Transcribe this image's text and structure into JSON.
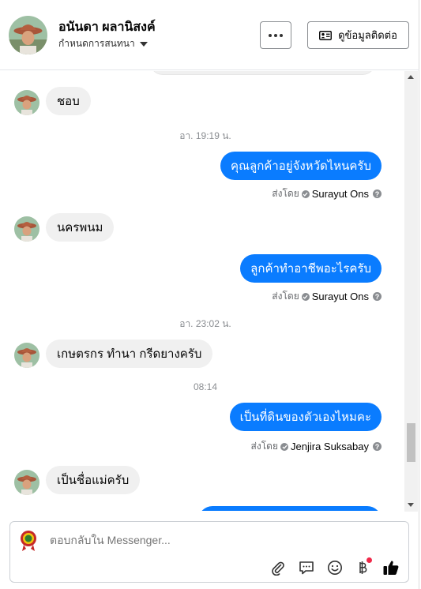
{
  "header": {
    "name": "อนันดา ผลานิสงค์",
    "subtitle": "กำหนดการสนทนา",
    "contact_button_label": "ดูข้อมูลติดต่อ",
    "more_button_icon": "ellipsis-icon"
  },
  "messages": {
    "m1": {
      "text": "ชอบ"
    },
    "t1": {
      "text": "อา. 19:19 น."
    },
    "m2": {
      "text": "คุณลูกค้าอยู่จังหวัดไหนครับ",
      "sentby_prefix": "ส่งโดย",
      "sender": "Surayut Ons"
    },
    "m3": {
      "text": "นครพนม"
    },
    "m4": {
      "text": "ลูกค้าทำอาชีพอะไรครับ",
      "sentby_prefix": "ส่งโดย",
      "sender": "Surayut Ons"
    },
    "t2": {
      "text": "อา. 23:02 น."
    },
    "m5": {
      "text": "เกษตรกร ทำนา กรีดยางครับ"
    },
    "t3": {
      "text": "08:14"
    },
    "m6": {
      "text": "เป็นที่ดินของตัวเองไหมคะ",
      "sentby_prefix": "ส่งโดย",
      "sender": "Jenjira Suksabay"
    },
    "m7": {
      "text": "เป็นชื่อแม่ครับ"
    }
  },
  "composer": {
    "placeholder": "ตอบกลับใน Messenger...",
    "tools": [
      "paperclip-icon",
      "chat-bubble-icon",
      "smiley-icon",
      "baht-icon",
      "thumbs-up-icon"
    ]
  },
  "colors": {
    "outgoing_bubble": "#0a7cff",
    "incoming_bubble": "#f0f0f0",
    "badge": "#f02849",
    "thumbs_up": "#050505"
  }
}
